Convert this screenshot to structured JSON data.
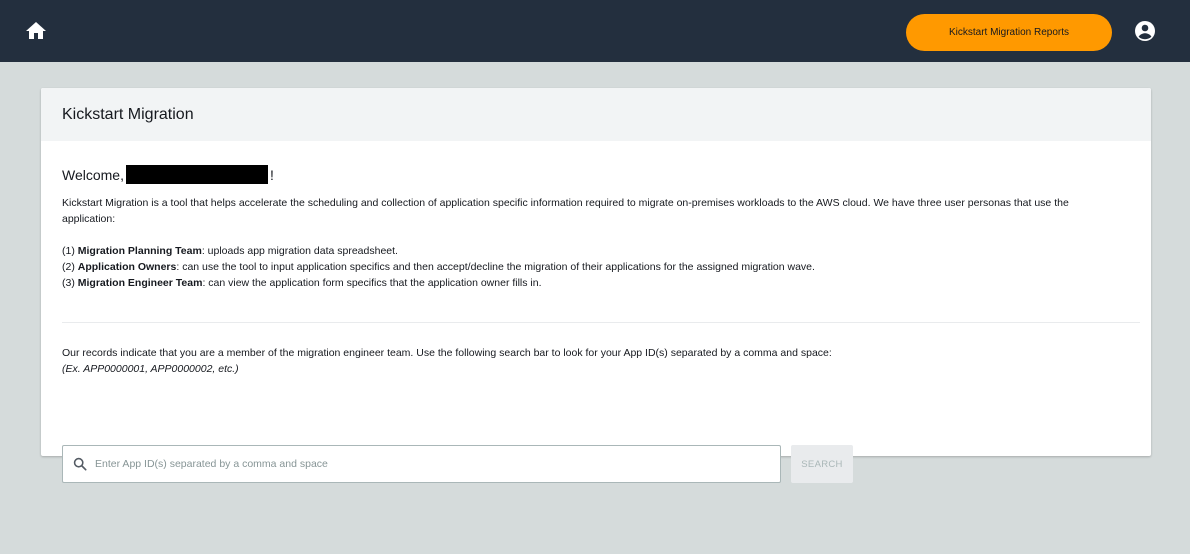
{
  "header": {
    "home_icon": "home-icon",
    "reports_button": "Kickstart Migration Reports",
    "account_icon": "account-circle-icon",
    "accent_color": "#ff9900",
    "bar_color": "#232f3e"
  },
  "card": {
    "title": "Kickstart Migration",
    "welcome_prefix": "Welcome,",
    "welcome_suffix": "!",
    "intro": "Kickstart Migration is a tool that helps accelerate the scheduling and collection of application specific information required to migrate on-premises workloads to the AWS cloud. We have three user personas that use the application:",
    "personas": [
      {
        "number": "(1)",
        "name": "Migration Planning Team",
        "description": ": uploads app migration data spreadsheet."
      },
      {
        "number": "(2)",
        "name": "Application Owners",
        "description": ": can use the tool to input application specifics and then accept/decline the migration of their applications for the assigned migration wave."
      },
      {
        "number": "(3)",
        "name": "Migration Engineer Team",
        "description": ": can view the application form specifics that the application owner fills in."
      }
    ],
    "records_text": "Our records indicate that you are a member of the migration engineer team. Use the following search bar to look for your App ID(s) separated by a comma and space:",
    "example_text": "(Ex. APP0000001, APP0000002, etc.)",
    "search": {
      "placeholder": "Enter App ID(s) separated by a comma and space",
      "value": "",
      "button_label": "SEARCH"
    }
  }
}
